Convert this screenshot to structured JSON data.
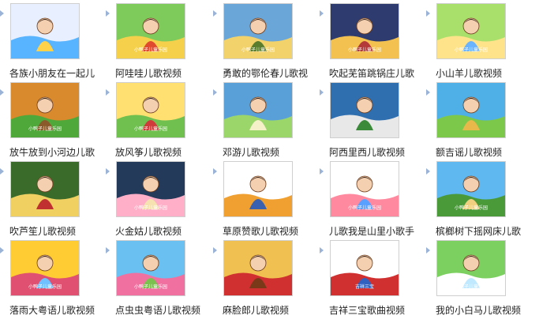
{
  "videos": [
    {
      "title": "各族小朋友在一起儿",
      "icon": "children-group-icon",
      "colors": [
        "#e8f0ff",
        "#59b4ff",
        "#ffd24a"
      ],
      "watermark": ""
    },
    {
      "title": "阿哇哇儿歌视频",
      "icon": "birds-jungle-icon",
      "colors": [
        "#7ecb5b",
        "#f5d04b",
        "#e04a2f"
      ],
      "watermark": "小鸭子儿童乐园"
    },
    {
      "title": "勇敢的鄂伦春儿歌视",
      "icon": "rider-horse-icon",
      "colors": [
        "#6aa6d8",
        "#f2d26b",
        "#5a7c2d"
      ],
      "watermark": "小鸭子儿童乐园"
    },
    {
      "title": "吹起芜笛跳锅庄儿歌",
      "icon": "dancers-icon",
      "colors": [
        "#2e3b6f",
        "#f2c14f",
        "#b43a3a"
      ],
      "watermark": "小鸭子儿童乐园"
    },
    {
      "title": "小山羊儿歌视频",
      "icon": "goats-field-icon",
      "colors": [
        "#a9e06c",
        "#ffe38a",
        "#6ab3ff"
      ],
      "watermark": "小鸭子儿童乐园"
    },
    {
      "title": "放牛放到小河边儿歌",
      "icon": "tree-river-icon",
      "colors": [
        "#d98a2c",
        "#4fa83a",
        "#8b5a2b"
      ],
      "watermark": "小鸭子儿童乐园"
    },
    {
      "title": "放风筝儿歌视频",
      "icon": "kite-kids-icon",
      "colors": [
        "#ffe070",
        "#70c050",
        "#d03a3a"
      ],
      "watermark": "小鸭子儿童乐园"
    },
    {
      "title": "邓游儿歌视频",
      "icon": "river-trees-icon",
      "colors": [
        "#5aa0d8",
        "#9bd66b",
        "#f5f0c8"
      ],
      "watermark": ""
    },
    {
      "title": "阿西里西儿歌视频",
      "icon": "ethnic-child-icon",
      "colors": [
        "#2f6fb0",
        "#e8e8e8",
        "#3a8a3a"
      ],
      "watermark": ""
    },
    {
      "title": "额吉谣儿歌视频",
      "icon": "hills-yurt-icon",
      "colors": [
        "#4fb0e8",
        "#7cc84a",
        "#e8b84a"
      ],
      "watermark": ""
    },
    {
      "title": "吹芦笙儿歌视频",
      "icon": "forest-dance-icon",
      "colors": [
        "#3b6b2a",
        "#f0d060",
        "#c03030"
      ],
      "watermark": ""
    },
    {
      "title": "火金姑儿歌视频",
      "icon": "girl-night-icon",
      "colors": [
        "#233a5a",
        "#ffb0c8",
        "#f5e2b0"
      ],
      "watermark": "小鸭子儿童乐园"
    },
    {
      "title": "草原赞歌儿歌视频",
      "icon": "girl-costume-icon",
      "colors": [
        "#ffffff",
        "#f0a030",
        "#3a60b0"
      ],
      "watermark": ""
    },
    {
      "title": "儿歌我是山里小歌手",
      "icon": "mountain-singer-icon",
      "colors": [
        "#ffffff",
        "#ff8aa0",
        "#5aa0ff"
      ],
      "watermark": "小鸭子儿童乐园"
    },
    {
      "title": "槟榔树下摇网床儿歌",
      "icon": "hammock-palms-icon",
      "colors": [
        "#5fb8f0",
        "#4a9a3a",
        "#f0d080"
      ],
      "watermark": "小鸭子儿童乐园"
    },
    {
      "title": "落雨大粤语儿歌视频",
      "icon": "rain-town-icon",
      "colors": [
        "#ffcc33",
        "#e05070",
        "#70c0ff"
      ],
      "watermark": "小鸭子儿童乐园"
    },
    {
      "title": "点虫虫粤语儿歌视频",
      "icon": "girl-garden-icon",
      "colors": [
        "#6ac0f0",
        "#f070a0",
        "#7cc050"
      ],
      "watermark": "小鸭子儿童乐园"
    },
    {
      "title": "麻脸郎儿歌视频",
      "icon": "couple-red-icon",
      "colors": [
        "#f0c050",
        "#d03030",
        "#7a3a1a"
      ],
      "watermark": ""
    },
    {
      "title": "吉祥三宝歌曲视频",
      "icon": "family-three-icon",
      "colors": [
        "#ffffff",
        "#d03030",
        "#3060c0"
      ],
      "watermark": "吉祥三宝"
    },
    {
      "title": "我的小白马儿歌视频",
      "icon": "white-horse-icon",
      "colors": [
        "#7cd060",
        "#ffffff",
        "#c0e8ff"
      ],
      "watermark": "小鸭子儿童乐园"
    }
  ]
}
